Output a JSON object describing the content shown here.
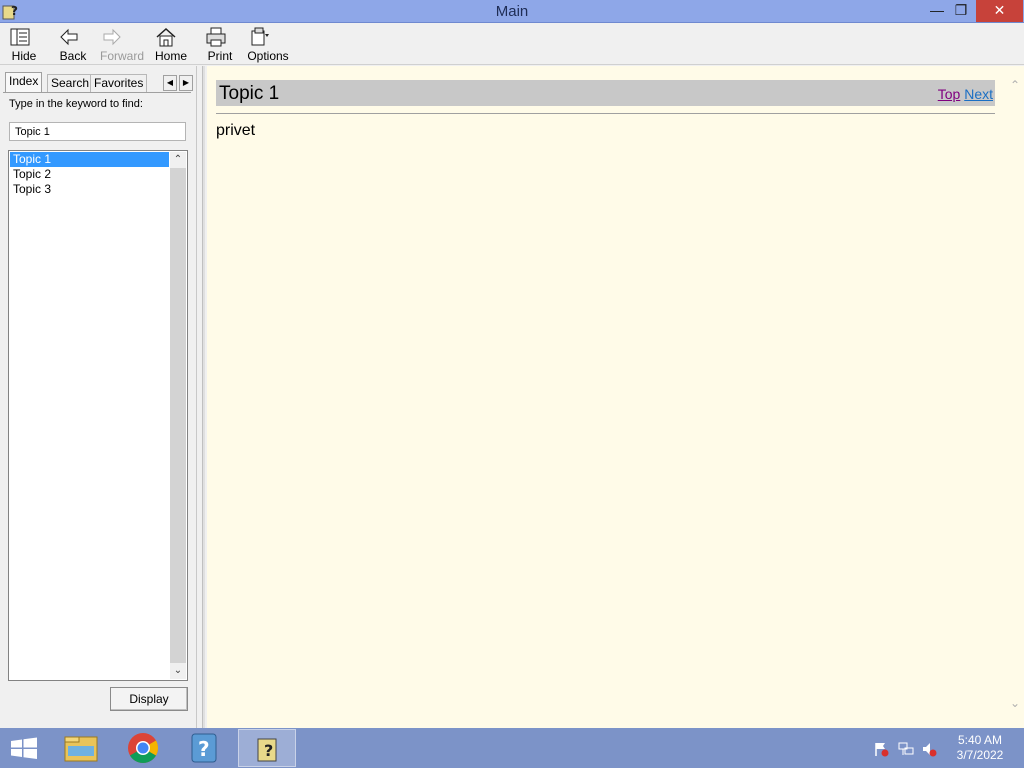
{
  "window": {
    "title": "Main"
  },
  "toolbar": {
    "hide": "Hide",
    "back": "Back",
    "forward": "Forward",
    "home": "Home",
    "print": "Print",
    "options": "Options"
  },
  "nav": {
    "tabs": [
      "Index",
      "Search",
      "Favorites"
    ],
    "find_label": "Type in the keyword to find:",
    "keyword_value": "Topic 1",
    "topics": [
      "Topic 1",
      "Topic 2",
      "Topic 3"
    ],
    "selected_topic": "Topic 1",
    "display_button": "Display"
  },
  "content": {
    "title": "Topic 1",
    "link_top": "Top",
    "link_next": "Next",
    "body": "privet"
  },
  "taskbar": {
    "time": "5:40 AM",
    "date": "3/7/2022"
  },
  "colors": {
    "titlebar": "#8ea7e8",
    "close_button": "#c7423a",
    "selection": "#3399ff",
    "content_bg": "#fffbe8",
    "header_bar": "#c8c8c8",
    "taskbar": "#7c93c8"
  }
}
